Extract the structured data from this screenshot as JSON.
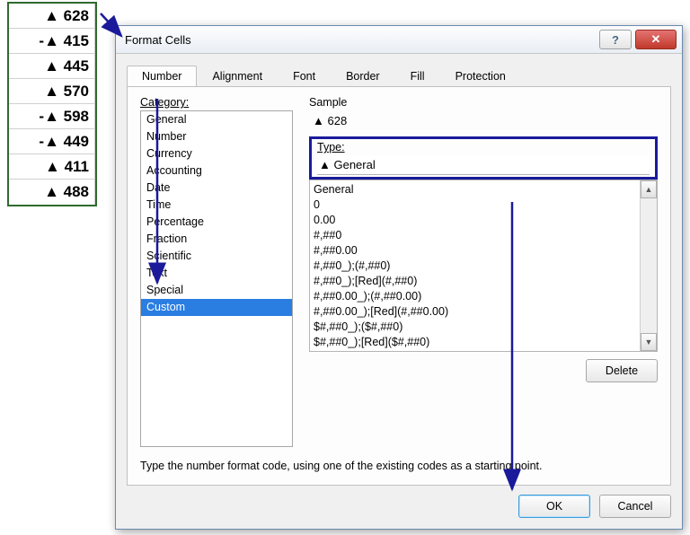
{
  "cells": [
    "▲ 628",
    "-▲ 415",
    "▲ 445",
    "▲ 570",
    "-▲ 598",
    "-▲ 449",
    "▲ 411",
    "▲ 488"
  ],
  "dialog": {
    "title": "Format Cells",
    "help_glyph": "?",
    "close_glyph": "✕",
    "tabs": [
      "Number",
      "Alignment",
      "Font",
      "Border",
      "Fill",
      "Protection"
    ],
    "category_label": "Category:",
    "categories": [
      "General",
      "Number",
      "Currency",
      "Accounting",
      "Date",
      "Time",
      "Percentage",
      "Fraction",
      "Scientific",
      "Text",
      "Special",
      "Custom"
    ],
    "selected_category": "Custom",
    "sample_label": "Sample",
    "sample_value": "▲ 628",
    "type_label": "Type:",
    "type_value": "▲ General",
    "format_codes": [
      "General",
      "0",
      "0.00",
      "#,##0",
      "#,##0.00",
      "#,##0_);(#,##0)",
      "#,##0_);[Red](#,##0)",
      "#,##0.00_);(#,##0.00)",
      "#,##0.00_);[Red](#,##0.00)",
      "$#,##0_);($#,##0)",
      "$#,##0_);[Red]($#,##0)"
    ],
    "delete_label": "Delete",
    "hint": "Type the number format code, using one of the existing codes as a starting point.",
    "ok_label": "OK",
    "cancel_label": "Cancel",
    "scroll_up": "▲",
    "scroll_down": "▼"
  }
}
